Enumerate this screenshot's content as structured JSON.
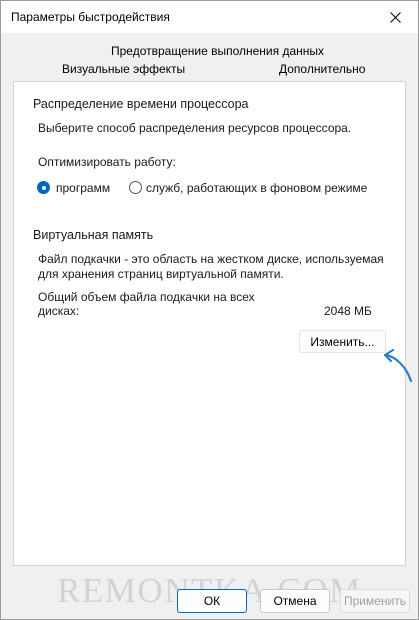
{
  "window": {
    "title": "Параметры быстродействия"
  },
  "tabs": {
    "dep": "Предотвращение выполнения данных",
    "visual": "Визуальные эффекты",
    "advanced": "Дополнительно"
  },
  "cpu": {
    "title": "Распределение времени процессора",
    "desc": "Выберите способ распределения ресурсов процессора.",
    "optimize_label": "Оптимизировать работу:",
    "options": [
      {
        "label": "программ",
        "checked": true
      },
      {
        "label": "служб, работающих в фоновом режиме",
        "checked": false
      }
    ]
  },
  "vm": {
    "title": "Виртуальная память",
    "desc_line1": "Файл подкачки - это область на жестком диске, используемая",
    "desc_line2": "для хранения страниц виртуальной памяти.",
    "total_line1": "Общий объем файла подкачки на всех",
    "total_line2": "дисках:",
    "total_value": "2048 МБ",
    "change_label": "Изменить..."
  },
  "buttons": {
    "ok": "ОК",
    "cancel": "Отмена",
    "apply": "Применить"
  },
  "watermark": "REMONTKA.COM",
  "colors": {
    "accent": "#0067c0",
    "arrow": "#2a7fc8"
  }
}
